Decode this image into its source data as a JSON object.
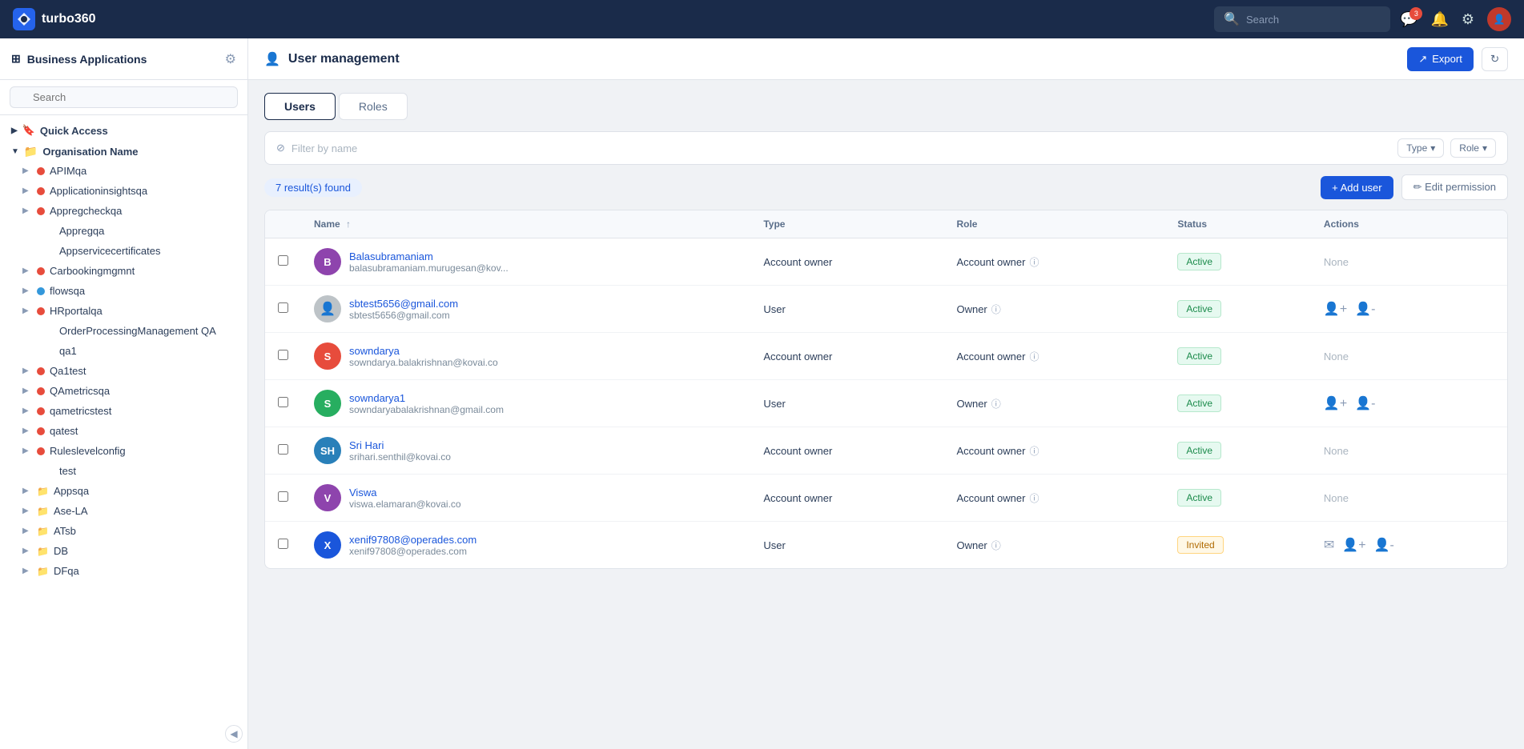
{
  "app": {
    "name": "turbo360"
  },
  "topnav": {
    "search_placeholder": "Search",
    "notification_count": "3",
    "icons": {
      "notifications": "🔔",
      "settings": "⚙",
      "messages": "💬"
    }
  },
  "sidebar": {
    "title": "Business Applications",
    "search_placeholder": "Search",
    "quick_access_label": "Quick Access",
    "org_label": "Organisation Name",
    "items": [
      {
        "name": "APIMqa",
        "dot": "red",
        "indent": 1
      },
      {
        "name": "Applicationinsightsqa",
        "dot": "red",
        "indent": 1
      },
      {
        "name": "Appregcheckqa",
        "dot": "red",
        "indent": 1
      },
      {
        "name": "Appregqa",
        "dot": "none",
        "indent": 2
      },
      {
        "name": "Appservicecertificates",
        "dot": "none",
        "indent": 2
      },
      {
        "name": "Carbookingmgmnt",
        "dot": "red",
        "indent": 1
      },
      {
        "name": "flowsqa",
        "dot": "blue",
        "indent": 1
      },
      {
        "name": "HRportalqa",
        "dot": "red",
        "indent": 1
      },
      {
        "name": "OrderProcessingManagement QA",
        "dot": "none",
        "indent": 2
      },
      {
        "name": "qa1",
        "dot": "none",
        "indent": 2
      },
      {
        "name": "Qa1test",
        "dot": "red",
        "indent": 1
      },
      {
        "name": "QAmetricsqa",
        "dot": "red",
        "indent": 1
      },
      {
        "name": "qametricstest",
        "dot": "red",
        "indent": 1
      },
      {
        "name": "qatest",
        "dot": "red",
        "indent": 1
      },
      {
        "name": "Ruleslevelconfig",
        "dot": "red",
        "indent": 1
      },
      {
        "name": "test",
        "dot": "none",
        "indent": 2
      },
      {
        "name": "Appsqa",
        "folder": true,
        "indent": 1
      },
      {
        "name": "Ase-LA",
        "folder": true,
        "indent": 1
      },
      {
        "name": "ATsb",
        "folder": true,
        "indent": 1
      },
      {
        "name": "DB",
        "folder": true,
        "indent": 1
      },
      {
        "name": "DFqa",
        "folder": true,
        "indent": 1
      }
    ]
  },
  "page": {
    "title": "User management",
    "export_label": "Export",
    "tabs": [
      {
        "id": "users",
        "label": "Users",
        "active": true
      },
      {
        "id": "roles",
        "label": "Roles",
        "active": false
      }
    ],
    "filter_placeholder": "Filter by name",
    "type_label": "Type",
    "role_label": "Role",
    "results_count": "7 result(s) found",
    "add_user_label": "+ Add user",
    "edit_permission_label": "✏ Edit permission",
    "table": {
      "columns": [
        "",
        "Name",
        "Type",
        "Role",
        "Status",
        "Actions"
      ],
      "users": [
        {
          "id": "balasubramaniam",
          "initials": "B",
          "avatar_color": "#8e44ad",
          "name": "Balasubramaniam",
          "email": "balasubramaniam.murugesan@kov...",
          "type": "Account owner",
          "role": "Account owner",
          "status": "Active",
          "status_type": "active",
          "actions": "None"
        },
        {
          "id": "sbtest5656",
          "initials": "",
          "avatar_color": "#bdc3c7",
          "name": "sbtest5656@gmail.com",
          "email": "sbtest5656@gmail.com",
          "type": "User",
          "role": "Owner",
          "status": "Active",
          "status_type": "active",
          "actions": "icons"
        },
        {
          "id": "sowndarya",
          "initials": "S",
          "avatar_color": "#e74c3c",
          "name": "sowndarya",
          "email": "sowndarya.balakrishnan@kovai.co",
          "type": "Account owner",
          "role": "Account owner",
          "status": "Active",
          "status_type": "active",
          "actions": "None"
        },
        {
          "id": "sowndarya1",
          "initials": "S",
          "avatar_color": "#27ae60",
          "name": "sowndarya1",
          "email": "sowndaryabalakrishnan@gmail.com",
          "type": "User",
          "role": "Owner",
          "status": "Active",
          "status_type": "active",
          "actions": "icons"
        },
        {
          "id": "srihari",
          "initials": "SH",
          "avatar_color": "#2980b9",
          "name": "Sri Hari",
          "email": "srihari.senthil@kovai.co",
          "type": "Account owner",
          "role": "Account owner",
          "status": "Active",
          "status_type": "active",
          "actions": "None"
        },
        {
          "id": "viswa",
          "initials": "V",
          "avatar_color": "#8e44ad",
          "name": "Viswa",
          "email": "viswa.elamaran@kovai.co",
          "type": "Account owner",
          "role": "Account owner",
          "status": "Active",
          "status_type": "active",
          "actions": "None"
        },
        {
          "id": "xenif97808",
          "initials": "X",
          "avatar_color": "#1a56db",
          "name": "xenif97808@operades.com",
          "email": "xenif97808@operades.com",
          "type": "User",
          "role": "Owner",
          "status": "Invited",
          "status_type": "invited",
          "actions": "icons3"
        }
      ]
    }
  }
}
